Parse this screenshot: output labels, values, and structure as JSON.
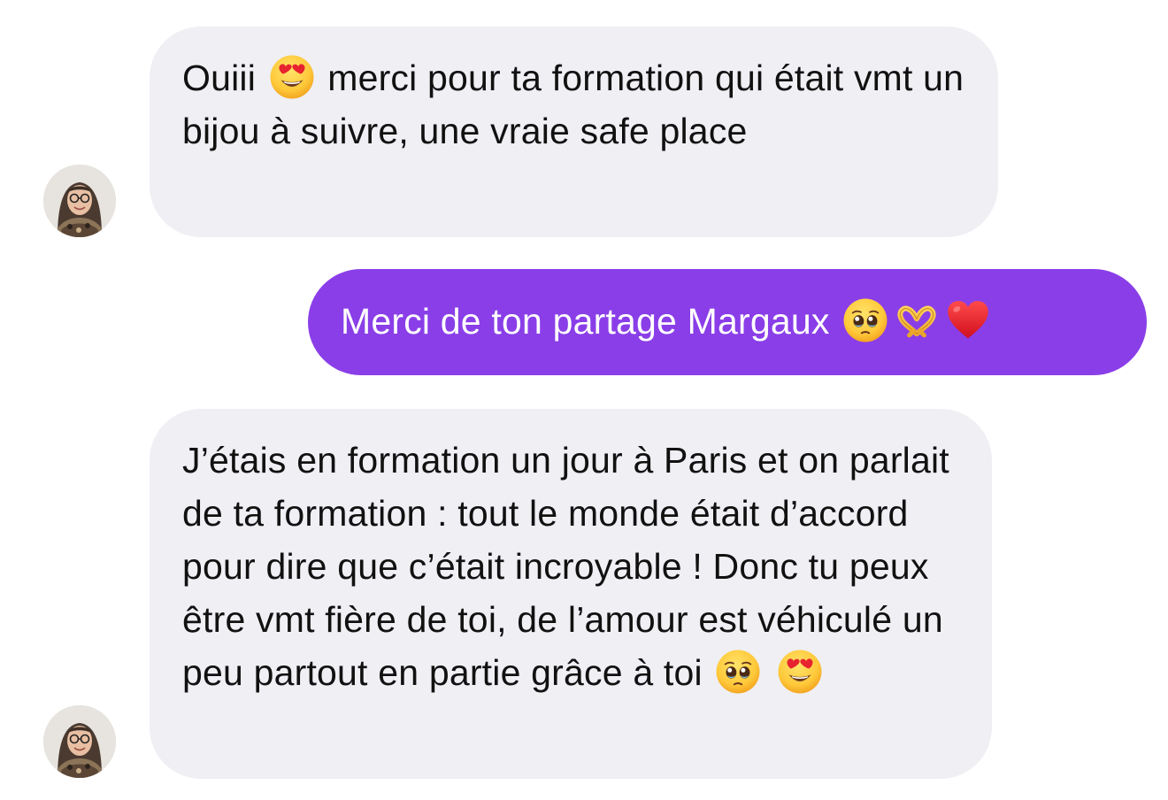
{
  "conversation": {
    "messages": [
      {
        "direction": "incoming",
        "text_parts": [
          "Ouiii ",
          " merci pour ta formation qui était vmt un bijou à suivre, une vraie safe place"
        ],
        "emojis": [
          "smiling-face-with-heart-eyes"
        ]
      },
      {
        "direction": "outgoing",
        "text": "Merci de ton partage Margaux ",
        "emojis": [
          "face-holding-back-tears",
          "heart-hands",
          "red-heart"
        ]
      },
      {
        "direction": "incoming",
        "text": "J’étais en formation un jour à Paris et on parlait de ta formation : tout le monde était d’accord pour dire que c’était incroyable ! Donc tu peux être vmt fière de toi, de l’amour est véhiculé un peu partout en partie grâce à toi ",
        "emojis": [
          "face-holding-back-tears",
          "smiling-face-with-heart-eyes"
        ]
      }
    ]
  },
  "colors": {
    "incoming_bubble": "#efeff4",
    "outgoing_bubble": "#8a3ee8",
    "incoming_text": "#111111",
    "outgoing_text": "#ffffff"
  }
}
